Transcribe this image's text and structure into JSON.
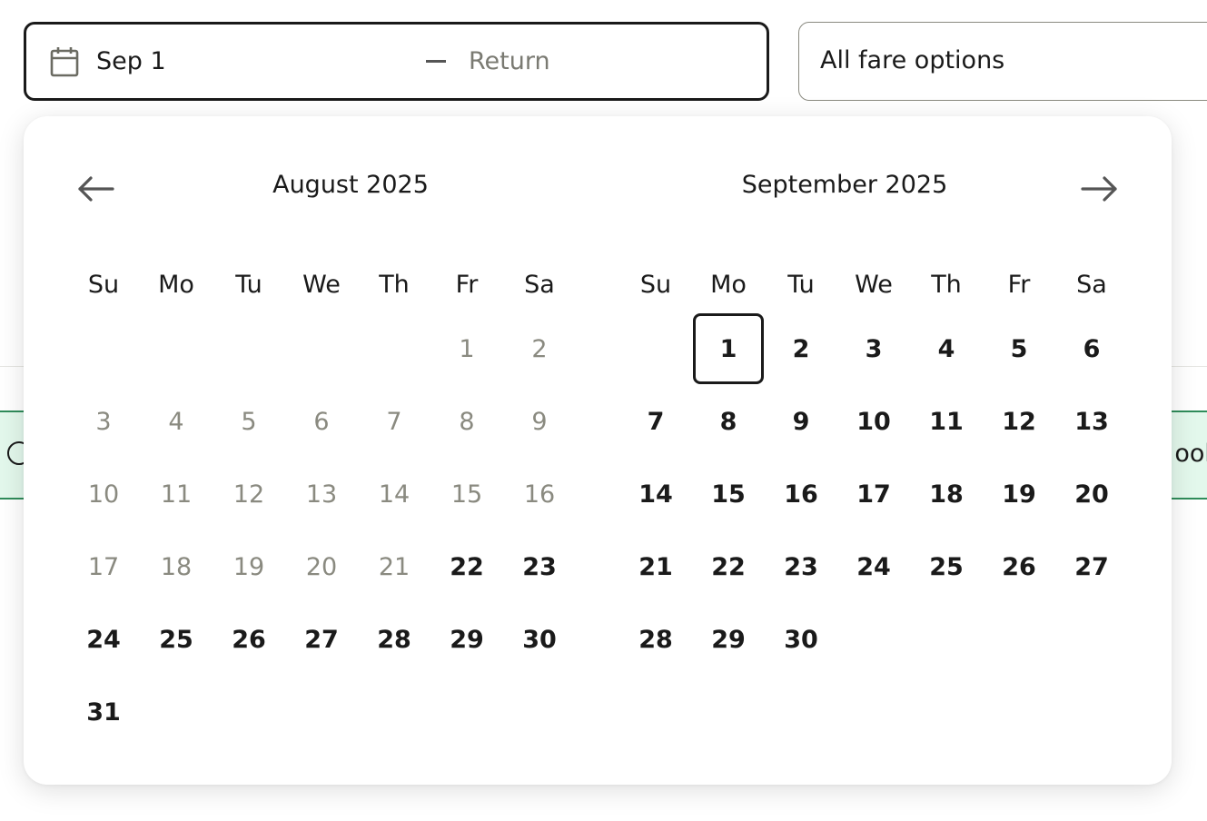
{
  "date_field": {
    "depart_value": "Sep 1",
    "return_placeholder": "Return"
  },
  "fare_select": {
    "value": "All fare options"
  },
  "background": {
    "banner_partial_text": "ook"
  },
  "calendar": {
    "weekdays": [
      "Su",
      "Mo",
      "Tu",
      "We",
      "Th",
      "Fr",
      "Sa"
    ],
    "selected_date": "2025-09-01",
    "months": [
      {
        "title": "August 2025",
        "weeks": [
          [
            null,
            null,
            null,
            null,
            null,
            {
              "d": "1",
              "disabled": true
            },
            {
              "d": "2",
              "disabled": true
            }
          ],
          [
            {
              "d": "3",
              "disabled": true
            },
            {
              "d": "4",
              "disabled": true
            },
            {
              "d": "5",
              "disabled": true
            },
            {
              "d": "6",
              "disabled": true
            },
            {
              "d": "7",
              "disabled": true
            },
            {
              "d": "8",
              "disabled": true
            },
            {
              "d": "9",
              "disabled": true
            }
          ],
          [
            {
              "d": "10",
              "disabled": true
            },
            {
              "d": "11",
              "disabled": true
            },
            {
              "d": "12",
              "disabled": true
            },
            {
              "d": "13",
              "disabled": true
            },
            {
              "d": "14",
              "disabled": true
            },
            {
              "d": "15",
              "disabled": true
            },
            {
              "d": "16",
              "disabled": true
            }
          ],
          [
            {
              "d": "17",
              "disabled": true
            },
            {
              "d": "18",
              "disabled": true
            },
            {
              "d": "19",
              "disabled": true
            },
            {
              "d": "20",
              "disabled": true
            },
            {
              "d": "21",
              "disabled": true
            },
            {
              "d": "22"
            },
            {
              "d": "23"
            }
          ],
          [
            {
              "d": "24"
            },
            {
              "d": "25"
            },
            {
              "d": "26"
            },
            {
              "d": "27"
            },
            {
              "d": "28"
            },
            {
              "d": "29"
            },
            {
              "d": "30"
            }
          ],
          [
            {
              "d": "31"
            },
            null,
            null,
            null,
            null,
            null,
            null
          ]
        ]
      },
      {
        "title": "September 2025",
        "weeks": [
          [
            null,
            {
              "d": "1",
              "selected": true
            },
            {
              "d": "2"
            },
            {
              "d": "3"
            },
            {
              "d": "4"
            },
            {
              "d": "5"
            },
            {
              "d": "6"
            }
          ],
          [
            {
              "d": "7"
            },
            {
              "d": "8"
            },
            {
              "d": "9"
            },
            {
              "d": "10"
            },
            {
              "d": "11"
            },
            {
              "d": "12"
            },
            {
              "d": "13"
            }
          ],
          [
            {
              "d": "14"
            },
            {
              "d": "15"
            },
            {
              "d": "16"
            },
            {
              "d": "17"
            },
            {
              "d": "18"
            },
            {
              "d": "19"
            },
            {
              "d": "20"
            }
          ],
          [
            {
              "d": "21"
            },
            {
              "d": "22"
            },
            {
              "d": "23"
            },
            {
              "d": "24"
            },
            {
              "d": "25"
            },
            {
              "d": "26"
            },
            {
              "d": "27"
            }
          ],
          [
            {
              "d": "28"
            },
            {
              "d": "29"
            },
            {
              "d": "30"
            },
            null,
            null,
            null,
            null
          ]
        ]
      }
    ],
    "icons": {
      "prev": "arrow-left-icon",
      "next": "arrow-right-icon",
      "field": "calendar-icon"
    }
  }
}
